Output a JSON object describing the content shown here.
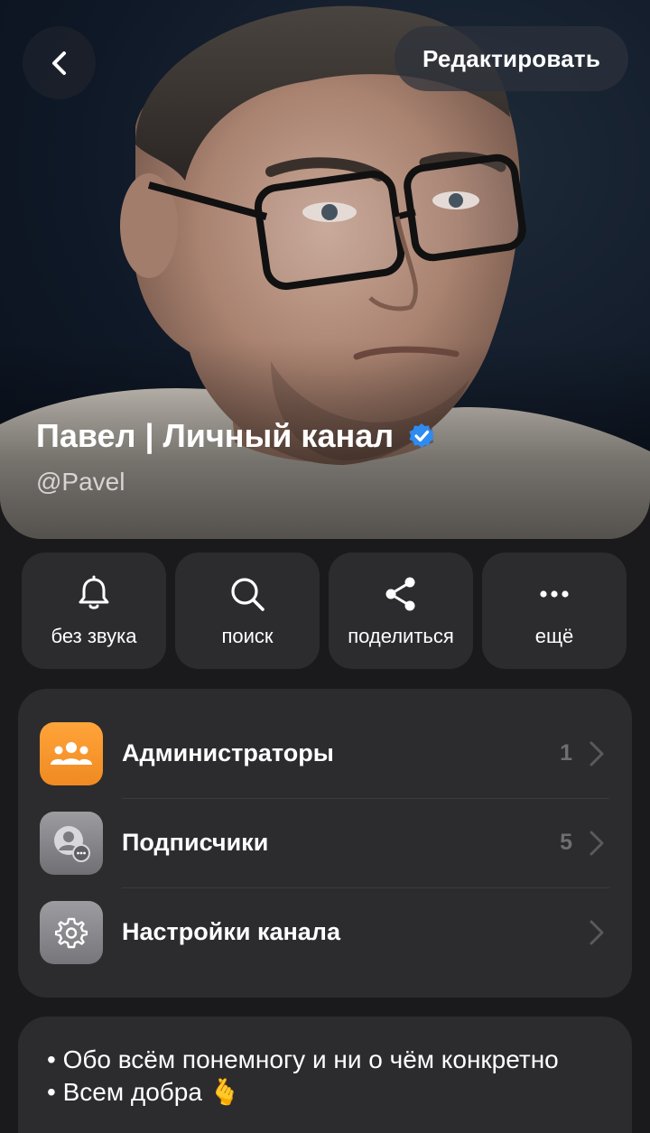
{
  "header": {
    "back_icon": "chevron-left-icon",
    "edit_label": "Редактировать",
    "channel_name": "Павел | Личный канал",
    "verified_icon": "verified-badge-icon",
    "handle": "@Pavel",
    "photo_icon": "channel-profile-photo"
  },
  "actions": [
    {
      "label": "без звука",
      "icon": "bell-icon"
    },
    {
      "label": "поиск",
      "icon": "search-icon"
    },
    {
      "label": "поделиться",
      "icon": "share-icon"
    },
    {
      "label": "ещё",
      "icon": "more-dots-icon"
    }
  ],
  "list": {
    "items": [
      {
        "title": "Администраторы",
        "count": "1",
        "icon": "admins-icon",
        "color": "#f5962a"
      },
      {
        "title": "Подписчики",
        "count": "5",
        "icon": "subscribers-icon",
        "color": "#8e8e93"
      },
      {
        "title": "Настройки канала",
        "count": "",
        "icon": "gear-icon",
        "color": "#8e8e93"
      }
    ]
  },
  "description": {
    "lines": [
      "• Обо всём понемногу и ни о чём конкретно",
      "• Всем добра 🫰"
    ]
  },
  "colors": {
    "background": "#1a1a1c",
    "card": "#2c2c2e",
    "accent_verified": "#2e8bf0",
    "admins_icon_bg": "#f5962a"
  }
}
